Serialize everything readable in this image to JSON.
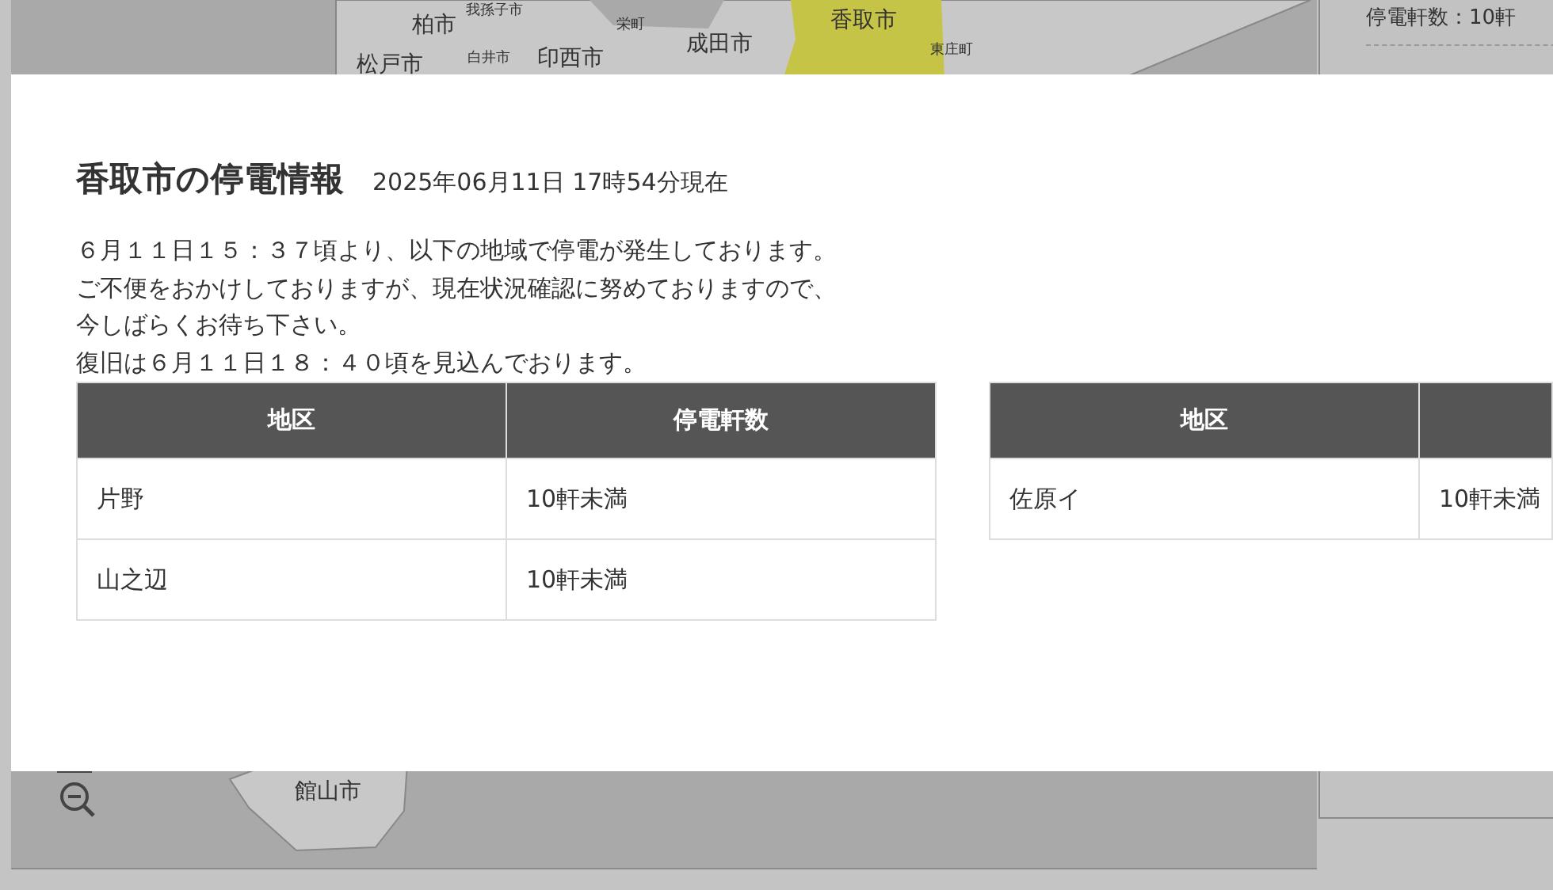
{
  "map": {
    "labels": [
      {
        "text": "我孫子市",
        "kind": "town",
        "highlighted": false
      },
      {
        "text": "柏市",
        "kind": "city",
        "highlighted": false
      },
      {
        "text": "栄町",
        "kind": "town",
        "highlighted": false
      },
      {
        "text": "松戸市",
        "kind": "city",
        "highlighted": false
      },
      {
        "text": "白井市",
        "kind": "town",
        "highlighted": false
      },
      {
        "text": "印西市",
        "kind": "city",
        "highlighted": false
      },
      {
        "text": "成田市",
        "kind": "city",
        "highlighted": false
      },
      {
        "text": "香取市",
        "kind": "city",
        "highlighted": true
      },
      {
        "text": "東庄町",
        "kind": "town",
        "highlighted": false
      },
      {
        "text": "館山市",
        "kind": "city",
        "highlighted": false
      }
    ]
  },
  "side_panel": {
    "text": "停電軒数：10軒"
  },
  "modal": {
    "title": "香取市の停電情報",
    "timestamp": "2025年06月11日 17時54分現在",
    "message_lines": [
      "６月１１日１５：３７頃より、以下の地域で停電が発生しております。",
      "ご不便をおかけしておりますが、現在状況確認に努めておりますので、",
      "今しばらくお待ち下さい。",
      "復旧は６月１１日１８：４０頃を見込んでおります。"
    ],
    "tables": [
      {
        "columns": [
          "地区",
          "停電軒数"
        ],
        "rows": [
          [
            "片野",
            "10軒未満"
          ],
          [
            "山之辺",
            "10軒未満"
          ]
        ]
      },
      {
        "columns": [
          "地区"
        ],
        "rows": [
          [
            "佐原イ",
            "10軒未満"
          ]
        ]
      }
    ]
  }
}
